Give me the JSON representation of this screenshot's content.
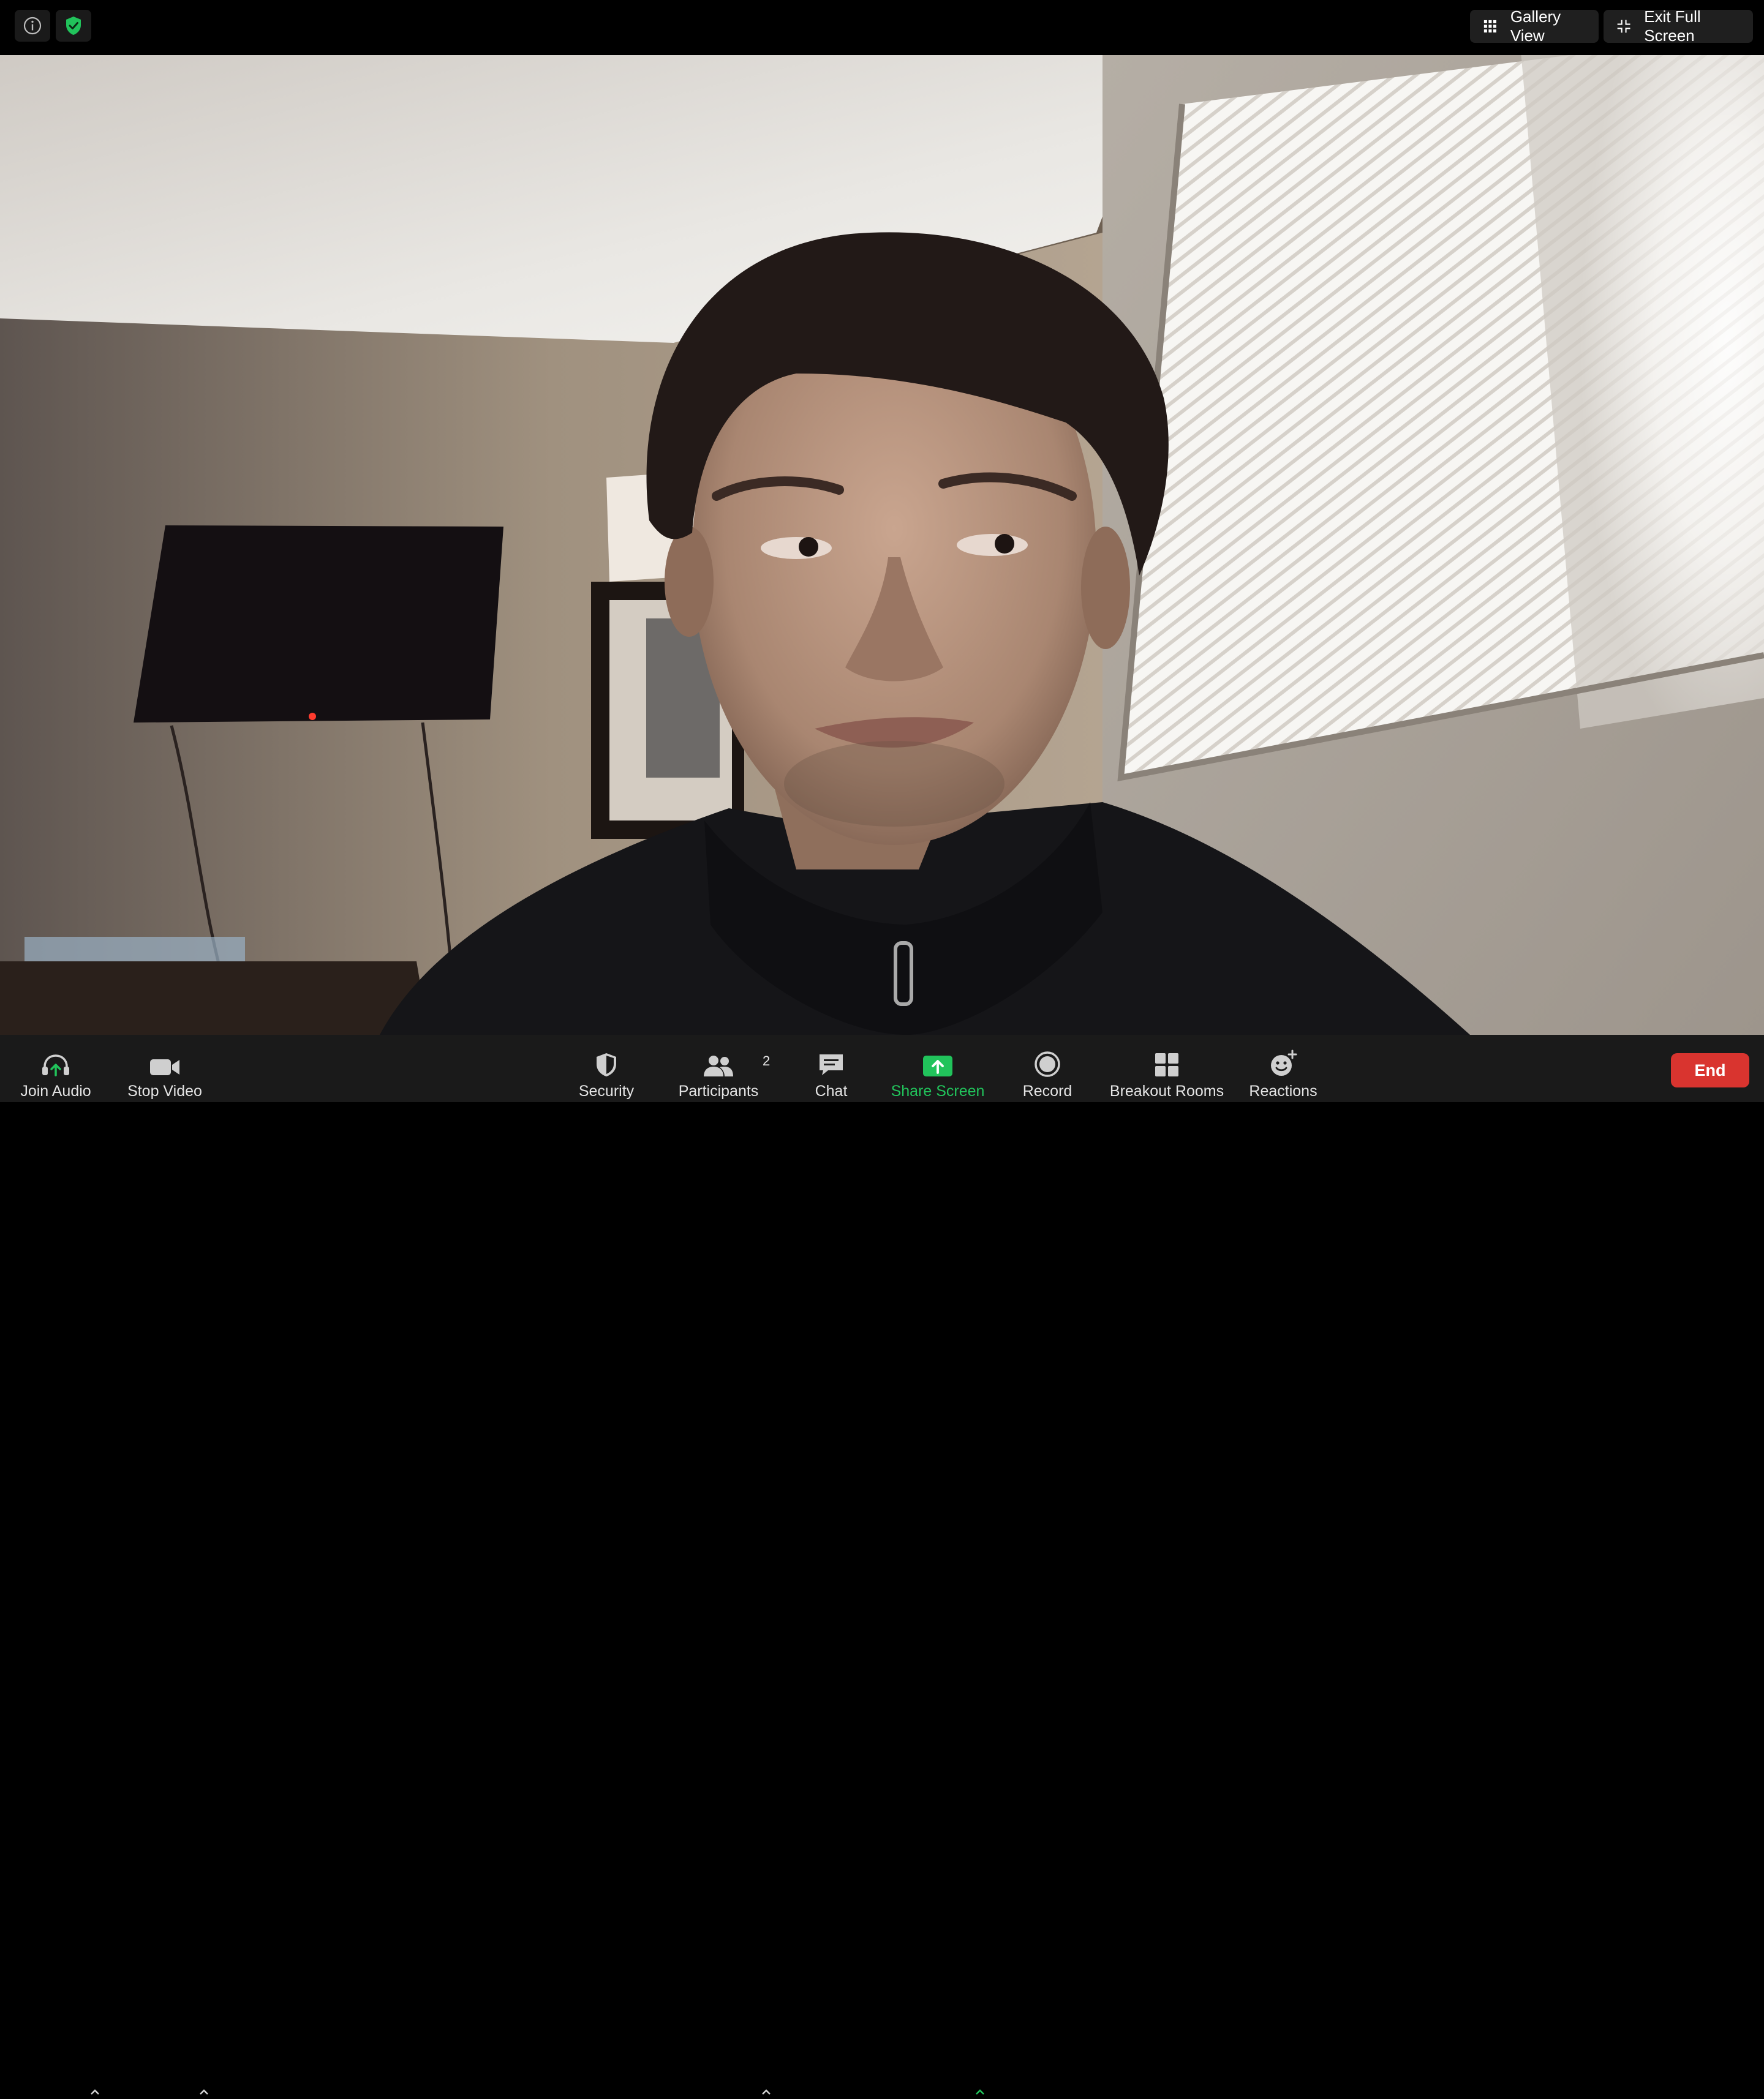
{
  "topbar": {
    "info_icon": "info-icon",
    "encryption_icon": "shield-check-icon",
    "gallery_view_label": "Gallery View",
    "exit_fullscreen_label": "Exit Full Screen"
  },
  "video": {
    "description_icon": "participant-video-feed"
  },
  "toolbar": {
    "join_audio": "Join Audio",
    "stop_video": "Stop Video",
    "security": "Security",
    "participants": "Participants",
    "participants_count": "2",
    "chat": "Chat",
    "share_screen": "Share Screen",
    "record": "Record",
    "breakout_rooms": "Breakout Rooms",
    "reactions": "Reactions",
    "end": "End"
  },
  "colors": {
    "accent_green": "#21c35b",
    "end_red": "#d9342f",
    "toolbar_bg": "#1a1a1a"
  }
}
